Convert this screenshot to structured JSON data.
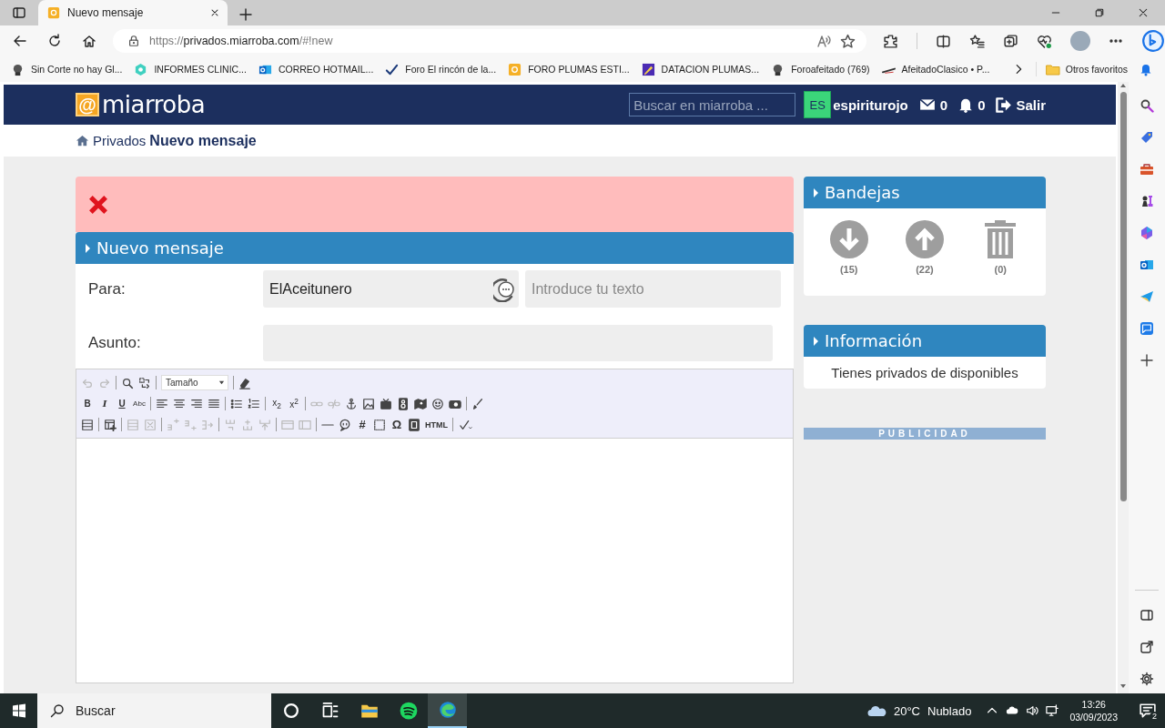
{
  "browser": {
    "tabs": [
      {
        "title": "Nuevo mensaje",
        "selected": true
      }
    ],
    "address": {
      "scheme": "https://",
      "host": "privados.miarroba.com",
      "path": "/#!new"
    },
    "bookmarks": [
      {
        "label": "Sin Corte no hay Gl...",
        "kind": "face"
      },
      {
        "label": "INFORMES CLINIC...",
        "kind": "gem"
      },
      {
        "label": "CORREO HOTMAIL...",
        "kind": "outlook"
      },
      {
        "label": "Foro El rincón de la...",
        "kind": "check"
      },
      {
        "label": "FORO PLUMAS ESTI...",
        "kind": "arroba"
      },
      {
        "label": "DATACION PLUMAS...",
        "kind": "pen"
      },
      {
        "label": "Foroafeitado (769)",
        "kind": "face"
      },
      {
        "label": "AfeitadoClasico • P...",
        "kind": "razor"
      }
    ],
    "other_bookmarks": "Otros favoritos"
  },
  "site": {
    "logo_mark": "@",
    "logo": "miarroba",
    "search_placeholder": "Buscar en miarroba ...",
    "avatar": "ES",
    "username": "espiriturojo",
    "messages": "0",
    "notifications": "0",
    "logout": "Salir"
  },
  "breadcrumb": [
    {
      "label": "Privados"
    },
    {
      "label": "Nuevo mensaje"
    }
  ],
  "alert": {
    "kind": "error"
  },
  "compose": {
    "title": "Nuevo mensaje",
    "to_label": "Para:",
    "recipients": [
      {
        "name": "ElAceitunero"
      }
    ],
    "to_placeholder": "Introduce tu texto",
    "subject_label": "Asunto:"
  },
  "editor": {
    "toolbar": [
      [
        {
          "kind": "undo",
          "disabled": true
        },
        {
          "kind": "redo",
          "disabled": true
        },
        {
          "kind": "sep"
        },
        {
          "kind": "find",
          "disabled": false
        },
        {
          "kind": "replace",
          "disabled": false
        },
        {
          "kind": "sep"
        },
        {
          "kind": "select",
          "label": "Tamaño",
          "disabled": false
        },
        {
          "kind": "sep"
        },
        {
          "kind": "eraser",
          "disabled": false
        }
      ],
      [
        {
          "kind": "bold",
          "label": "B",
          "disabled": false
        },
        {
          "kind": "italic",
          "label": "I",
          "disabled": false
        },
        {
          "kind": "underline",
          "label": "U",
          "disabled": false
        },
        {
          "kind": "strike",
          "label": "Abc",
          "disabled": false
        },
        {
          "kind": "sep"
        },
        {
          "kind": "align-left",
          "disabled": false
        },
        {
          "kind": "align-center",
          "disabled": false
        },
        {
          "kind": "align-right",
          "disabled": false
        },
        {
          "kind": "justify",
          "disabled": false
        },
        {
          "kind": "sep"
        },
        {
          "kind": "bullets",
          "disabled": false
        },
        {
          "kind": "numbers",
          "disabled": false
        },
        {
          "kind": "sep"
        },
        {
          "kind": "subscript",
          "label": "x$_{2}$",
          "disabled": false
        },
        {
          "kind": "superscript",
          "label": "x$^{2}$",
          "disabled": false
        },
        {
          "kind": "sep"
        },
        {
          "kind": "link",
          "disabled": true
        },
        {
          "kind": "unlink",
          "disabled": true
        },
        {
          "kind": "anchor",
          "disabled": false
        },
        {
          "kind": "image",
          "disabled": false
        },
        {
          "kind": "tv",
          "disabled": false
        },
        {
          "kind": "speaker",
          "disabled": false
        },
        {
          "kind": "map",
          "disabled": false
        },
        {
          "kind": "smiley",
          "disabled": false
        },
        {
          "kind": "camera",
          "disabled": false
        },
        {
          "kind": "sep"
        },
        {
          "kind": "brush",
          "disabled": false
        }
      ],
      [
        {
          "kind": "blocks",
          "disabled": false
        },
        {
          "kind": "sep"
        },
        {
          "kind": "table",
          "disabled": false
        },
        {
          "kind": "sep"
        },
        {
          "kind": "rows",
          "disabled": true
        },
        {
          "kind": "cell-delete",
          "disabled": true
        },
        {
          "kind": "sep"
        },
        {
          "kind": "row-before",
          "disabled": true
        },
        {
          "kind": "row-after",
          "disabled": true
        },
        {
          "kind": "row-delete",
          "disabled": true
        },
        {
          "kind": "sep"
        },
        {
          "kind": "col-before",
          "disabled": true
        },
        {
          "kind": "col-after",
          "disabled": true
        },
        {
          "kind": "col-delete",
          "disabled": true
        },
        {
          "kind": "sep"
        },
        {
          "kind": "split",
          "disabled": true
        },
        {
          "kind": "merge",
          "disabled": true
        },
        {
          "kind": "sep"
        },
        {
          "kind": "hr",
          "disabled": false
        },
        {
          "kind": "speech",
          "disabled": false
        },
        {
          "kind": "hash",
          "label": "#",
          "disabled": false
        },
        {
          "kind": "div",
          "disabled": false
        },
        {
          "kind": "omega",
          "label": "Ω",
          "disabled": false
        },
        {
          "kind": "page",
          "disabled": false
        },
        {
          "kind": "html",
          "label": "HTML",
          "disabled": false
        },
        {
          "kind": "sep"
        },
        {
          "kind": "spellcheck",
          "disabled": false
        }
      ]
    ]
  },
  "sidebar": {
    "trays": {
      "title": "Bandejas",
      "folders": [
        {
          "kind": "inbox",
          "count": "(15)"
        },
        {
          "kind": "sent",
          "count": "(22)"
        },
        {
          "kind": "trash",
          "count": "(0)"
        }
      ]
    },
    "info": {
      "title": "Información",
      "text": "Tienes privados de disponibles"
    },
    "ad_label": "PUBLICIDAD"
  },
  "taskbar": {
    "search_placeholder": "Buscar",
    "apps": [
      {
        "kind": "cortana",
        "selected": false
      },
      {
        "kind": "taskview",
        "selected": false
      },
      {
        "kind": "explorer",
        "selected": false
      },
      {
        "kind": "spotify",
        "selected": false
      },
      {
        "kind": "edge",
        "selected": true
      }
    ],
    "temperature": "20°C",
    "weather": "Nublado",
    "time": "13:26",
    "date": "03/09/2023",
    "notifications": "2"
  }
}
